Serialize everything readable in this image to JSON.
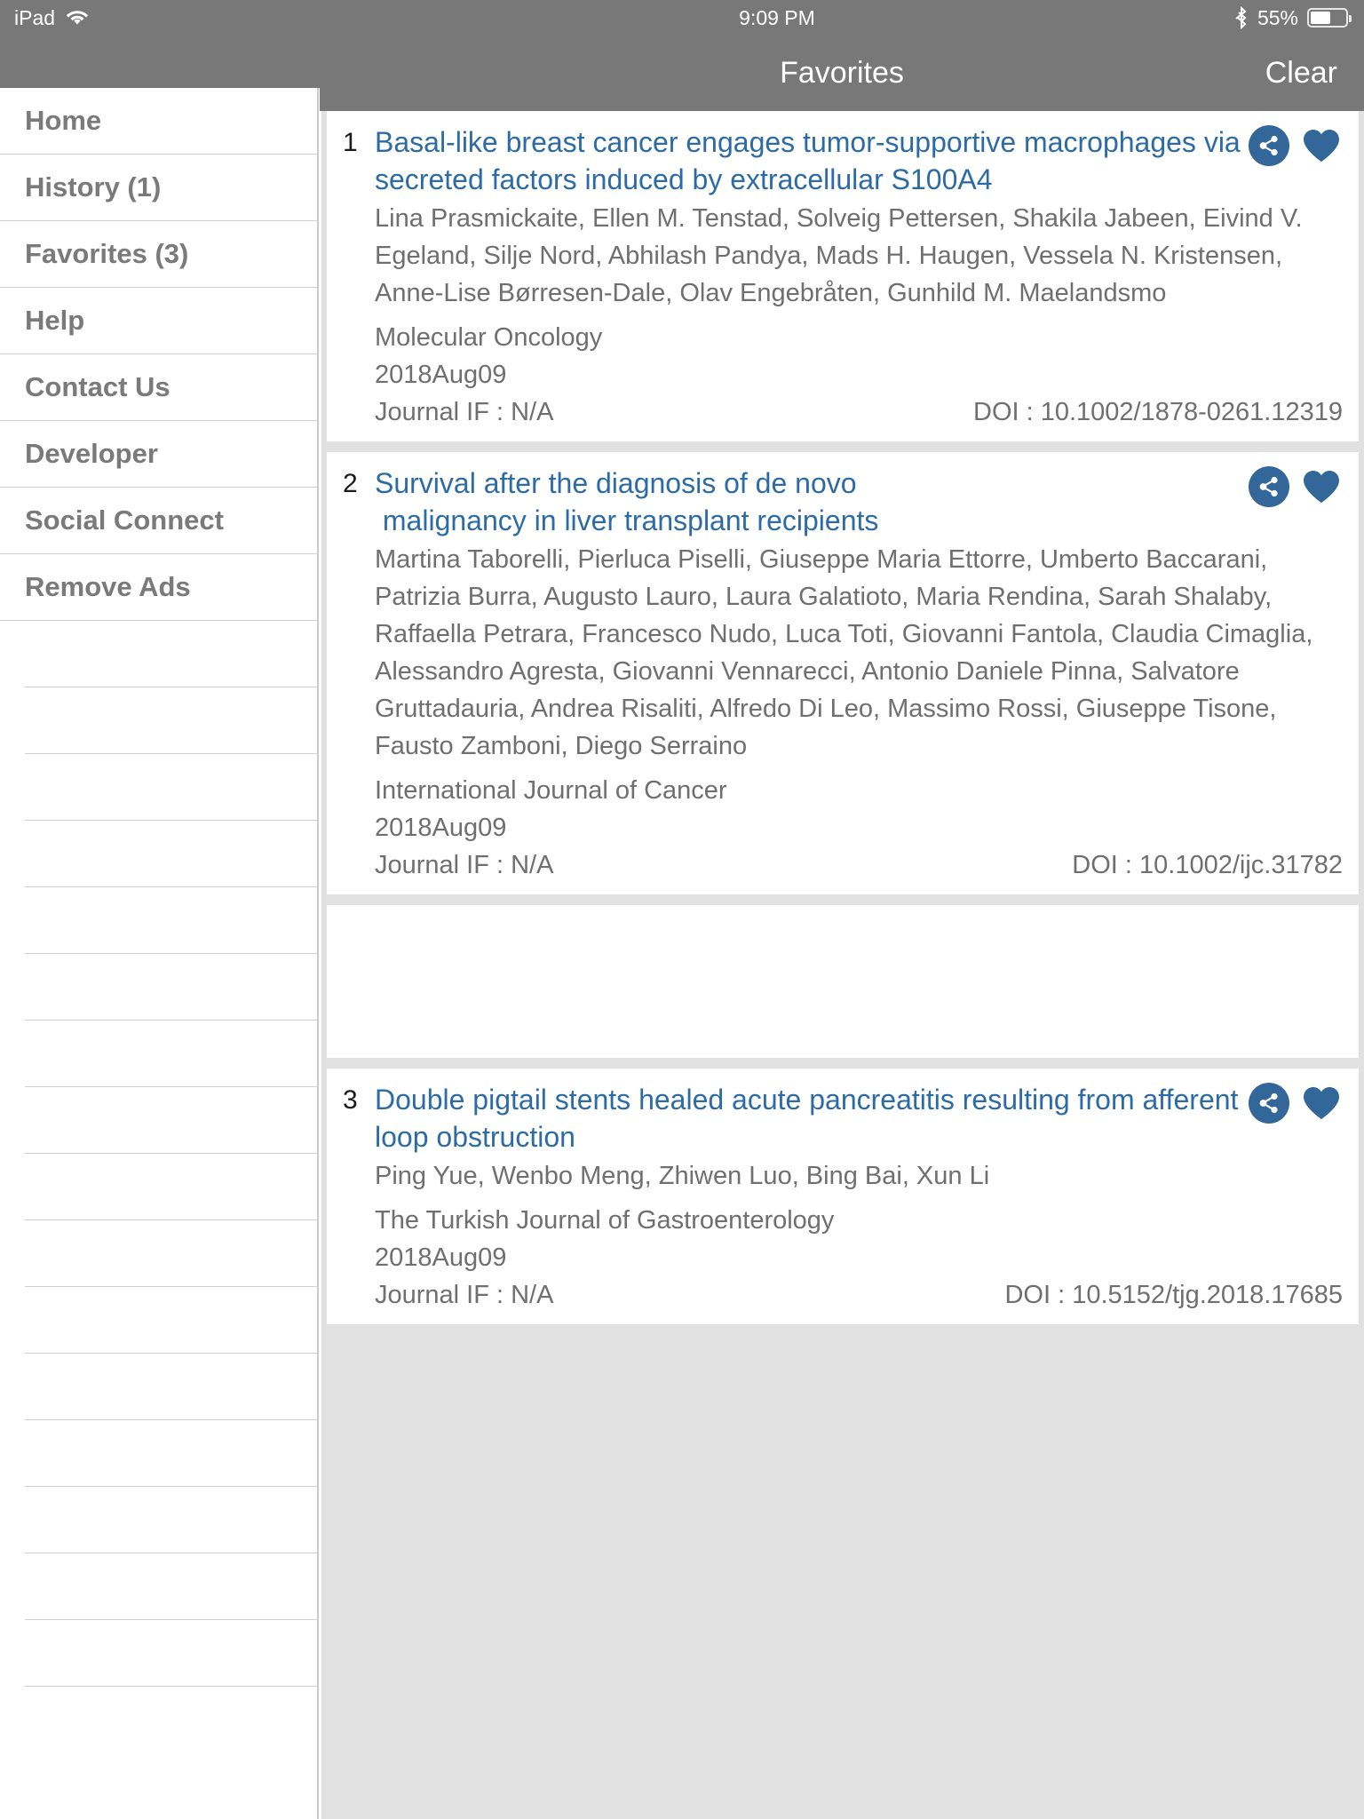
{
  "status_bar": {
    "device": "iPad",
    "wifi_icon": "wifi-icon",
    "time": "9:09 PM",
    "bluetooth_icon": "bluetooth-icon",
    "battery_percent": "55%",
    "battery_icon": "battery-icon"
  },
  "nav": {
    "title": "Favorites",
    "clear_label": "Clear"
  },
  "sidebar": {
    "items": [
      {
        "label": "Home"
      },
      {
        "label": "History (1)"
      },
      {
        "label": "Favorites (3)"
      },
      {
        "label": "Help"
      },
      {
        "label": "Contact Us"
      },
      {
        "label": "Developer"
      },
      {
        "label": "Social Connect"
      },
      {
        "label": "Remove Ads"
      }
    ],
    "blank_rows": 16
  },
  "colors": {
    "chrome_gray": "#787878",
    "title_blue": "#2d6ba6",
    "accent_blue": "#336699",
    "body_gray": "#6f6f6f",
    "page_bg": "#e1e1e1"
  },
  "articles": [
    {
      "number": "1",
      "title": "Basal-like breast cancer engages tumor-supportive macrophages via secreted factors induced by extracellular S100A4",
      "authors": "Lina Prasmickaite, Ellen M. Tenstad, Solveig Pettersen, Shakila Jabeen, Eivind V. Egeland, Silje Nord, Abhilash Pandya, Mads H. Haugen, Vessela N. Kristensen, Anne-Lise Børresen-Dale, Olav Engebråten, Gunhild M. Maelandsmo",
      "journal": "Molecular Oncology",
      "date": "2018Aug09",
      "impact_factor": "Journal IF : N/A",
      "doi": "DOI : 10.1002/1878-0261.12319",
      "share_icon": "share-icon",
      "favorite_icon": "heart-filled-icon"
    },
    {
      "number": "2",
      "title": "Survival after the diagnosis of de novo\n malignancy in liver transplant recipients",
      "authors": "Martina Taborelli, Pierluca Piselli, Giuseppe Maria Ettorre, Umberto Baccarani, Patrizia Burra, Augusto Lauro, Laura Galatioto, Maria Rendina, Sarah Shalaby, Raffaella Petrara, Francesco Nudo, Luca Toti, Giovanni Fantola, Claudia Cimaglia, Alessandro Agresta, Giovanni Vennarecci, Antonio Daniele Pinna, Salvatore Gruttadauria, Andrea Risaliti, Alfredo Di Leo, Massimo Rossi, Giuseppe Tisone, Fausto Zamboni, Diego Serraino",
      "journal": "International Journal of Cancer",
      "date": "2018Aug09",
      "impact_factor": "Journal IF : N/A",
      "doi": "DOI : 10.1002/ijc.31782",
      "share_icon": "share-icon",
      "favorite_icon": "heart-filled-icon"
    },
    {
      "number": "3",
      "title": "Double pigtail stents healed acute pancreatitis resulting from afferent loop obstruction",
      "authors": "Ping Yue, Wenbo Meng, Zhiwen Luo, Bing Bai, Xun Li",
      "journal": "The Turkish Journal of Gastroenterology",
      "date": "2018Aug09",
      "impact_factor": "Journal IF : N/A",
      "doi": "DOI : 10.5152/tjg.2018.17685",
      "share_icon": "share-icon",
      "favorite_icon": "heart-filled-icon"
    }
  ]
}
